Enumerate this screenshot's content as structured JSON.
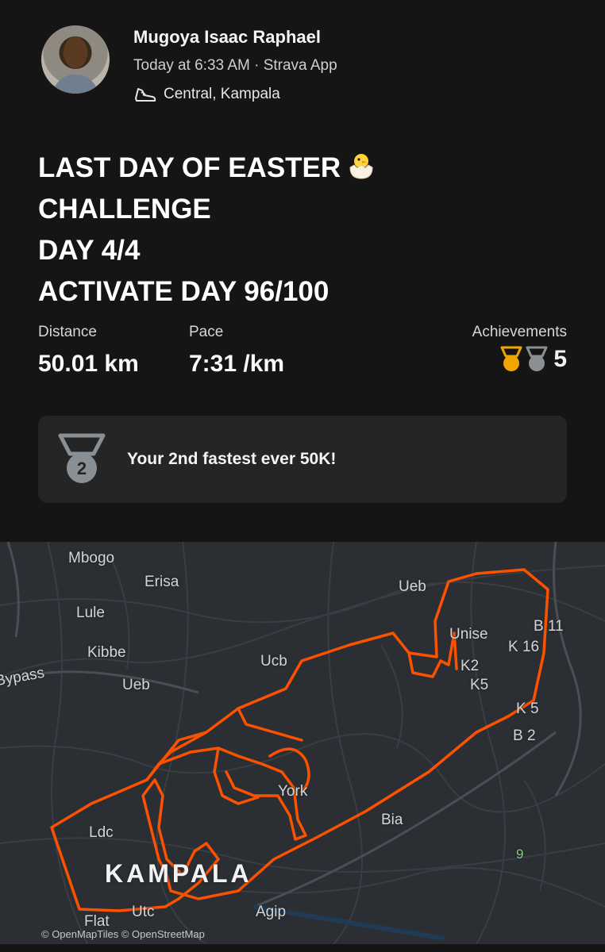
{
  "post": {
    "athlete_name": "Mugoya Isaac Raphael",
    "meta": "Today at 6:33 AM · Strava App",
    "location": "Central, Kampala",
    "title_lines": [
      "LAST DAY OF EASTER",
      "CHALLENGE",
      "DAY 4/4",
      "ACTIVATE DAY 96/100"
    ],
    "title_emoji": "hatching-chick-icon"
  },
  "stats": {
    "distance_label": "Distance",
    "distance_value": "50.01 km",
    "pace_label": "Pace",
    "pace_value": "7:31 /km",
    "achievements_label": "Achievements",
    "achievements_count": "5"
  },
  "highlight": {
    "medal_number": "2",
    "text": "Your 2nd fastest ever 50K!"
  },
  "map": {
    "labels": [
      "Mbogo",
      "Erisa",
      "Lule",
      "Kibbe",
      "Bypass",
      "Ueb",
      "Ucb",
      "Ueb",
      "Unise",
      "B 11",
      "K 16",
      "K2",
      "K5",
      "K 5",
      "B 2",
      "York",
      "Bia",
      "Ldc",
      "KAMPALA",
      "Utc",
      "Agip",
      "Flat",
      "9"
    ],
    "attribution": "© OpenMapTiles © OpenStreetMap"
  },
  "colors": {
    "background": "#151515",
    "card": "#252525",
    "route": "#fc5200",
    "gold": "#f0a500",
    "silver": "#8a8f94"
  }
}
